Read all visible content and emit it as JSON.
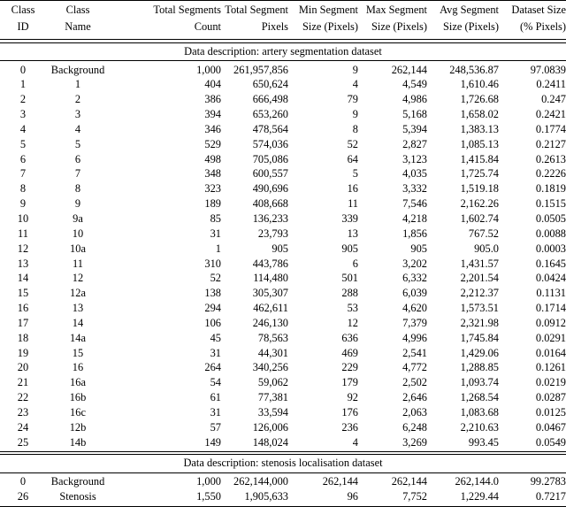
{
  "table": {
    "columns": [
      {
        "key": "class_id",
        "line1": "Class",
        "line2": "ID",
        "align": "center"
      },
      {
        "key": "class_name",
        "line1": "Class",
        "line2": "Name",
        "align": "center"
      },
      {
        "key": "total_count",
        "line1": "Total Segments",
        "line2": "Count",
        "align": "right"
      },
      {
        "key": "total_px",
        "line1": "Total Segment",
        "line2": "Pixels",
        "align": "right"
      },
      {
        "key": "min_px",
        "line1": "Min Segment",
        "line2": "Size (Pixels)",
        "align": "right"
      },
      {
        "key": "max_px",
        "line1": "Max Segment",
        "line2": "Size (Pixels)",
        "align": "right"
      },
      {
        "key": "avg_px",
        "line1": "Avg Segment",
        "line2": "Size (Pixels)",
        "align": "right"
      },
      {
        "key": "dataset_pct",
        "line1": "Dataset Size",
        "line2": "(% Pixels)",
        "align": "right"
      }
    ],
    "sections": [
      {
        "caption": "Data description: artery segmentation dataset",
        "rows": [
          {
            "class_id": "0",
            "class_name": "Background",
            "total_count": "1,000",
            "total_px": "261,957,856",
            "min_px": "9",
            "max_px": "262,144",
            "avg_px": "248,536.87",
            "dataset_pct": "97.0839"
          },
          {
            "class_id": "1",
            "class_name": "1",
            "total_count": "404",
            "total_px": "650,624",
            "min_px": "4",
            "max_px": "4,549",
            "avg_px": "1,610.46",
            "dataset_pct": "0.2411"
          },
          {
            "class_id": "2",
            "class_name": "2",
            "total_count": "386",
            "total_px": "666,498",
            "min_px": "79",
            "max_px": "4,986",
            "avg_px": "1,726.68",
            "dataset_pct": "0.247"
          },
          {
            "class_id": "3",
            "class_name": "3",
            "total_count": "394",
            "total_px": "653,260",
            "min_px": "9",
            "max_px": "5,168",
            "avg_px": "1,658.02",
            "dataset_pct": "0.2421"
          },
          {
            "class_id": "4",
            "class_name": "4",
            "total_count": "346",
            "total_px": "478,564",
            "min_px": "8",
            "max_px": "5,394",
            "avg_px": "1,383.13",
            "dataset_pct": "0.1774"
          },
          {
            "class_id": "5",
            "class_name": "5",
            "total_count": "529",
            "total_px": "574,036",
            "min_px": "52",
            "max_px": "2,827",
            "avg_px": "1,085.13",
            "dataset_pct": "0.2127"
          },
          {
            "class_id": "6",
            "class_name": "6",
            "total_count": "498",
            "total_px": "705,086",
            "min_px": "64",
            "max_px": "3,123",
            "avg_px": "1,415.84",
            "dataset_pct": "0.2613"
          },
          {
            "class_id": "7",
            "class_name": "7",
            "total_count": "348",
            "total_px": "600,557",
            "min_px": "5",
            "max_px": "4,035",
            "avg_px": "1,725.74",
            "dataset_pct": "0.2226"
          },
          {
            "class_id": "8",
            "class_name": "8",
            "total_count": "323",
            "total_px": "490,696",
            "min_px": "16",
            "max_px": "3,332",
            "avg_px": "1,519.18",
            "dataset_pct": "0.1819"
          },
          {
            "class_id": "9",
            "class_name": "9",
            "total_count": "189",
            "total_px": "408,668",
            "min_px": "11",
            "max_px": "7,546",
            "avg_px": "2,162.26",
            "dataset_pct": "0.1515"
          },
          {
            "class_id": "10",
            "class_name": "9a",
            "total_count": "85",
            "total_px": "136,233",
            "min_px": "339",
            "max_px": "4,218",
            "avg_px": "1,602.74",
            "dataset_pct": "0.0505"
          },
          {
            "class_id": "11",
            "class_name": "10",
            "total_count": "31",
            "total_px": "23,793",
            "min_px": "13",
            "max_px": "1,856",
            "avg_px": "767.52",
            "dataset_pct": "0.0088"
          },
          {
            "class_id": "12",
            "class_name": "10a",
            "total_count": "1",
            "total_px": "905",
            "min_px": "905",
            "max_px": "905",
            "avg_px": "905.0",
            "dataset_pct": "0.0003"
          },
          {
            "class_id": "13",
            "class_name": "11",
            "total_count": "310",
            "total_px": "443,786",
            "min_px": "6",
            "max_px": "3,202",
            "avg_px": "1,431.57",
            "dataset_pct": "0.1645"
          },
          {
            "class_id": "14",
            "class_name": "12",
            "total_count": "52",
            "total_px": "114,480",
            "min_px": "501",
            "max_px": "6,332",
            "avg_px": "2,201.54",
            "dataset_pct": "0.0424"
          },
          {
            "class_id": "15",
            "class_name": "12a",
            "total_count": "138",
            "total_px": "305,307",
            "min_px": "288",
            "max_px": "6,039",
            "avg_px": "2,212.37",
            "dataset_pct": "0.1131"
          },
          {
            "class_id": "16",
            "class_name": "13",
            "total_count": "294",
            "total_px": "462,611",
            "min_px": "53",
            "max_px": "4,620",
            "avg_px": "1,573.51",
            "dataset_pct": "0.1714"
          },
          {
            "class_id": "17",
            "class_name": "14",
            "total_count": "106",
            "total_px": "246,130",
            "min_px": "12",
            "max_px": "7,379",
            "avg_px": "2,321.98",
            "dataset_pct": "0.0912"
          },
          {
            "class_id": "18",
            "class_name": "14a",
            "total_count": "45",
            "total_px": "78,563",
            "min_px": "636",
            "max_px": "4,996",
            "avg_px": "1,745.84",
            "dataset_pct": "0.0291"
          },
          {
            "class_id": "19",
            "class_name": "15",
            "total_count": "31",
            "total_px": "44,301",
            "min_px": "469",
            "max_px": "2,541",
            "avg_px": "1,429.06",
            "dataset_pct": "0.0164"
          },
          {
            "class_id": "20",
            "class_name": "16",
            "total_count": "264",
            "total_px": "340,256",
            "min_px": "229",
            "max_px": "4,772",
            "avg_px": "1,288.85",
            "dataset_pct": "0.1261"
          },
          {
            "class_id": "21",
            "class_name": "16a",
            "total_count": "54",
            "total_px": "59,062",
            "min_px": "179",
            "max_px": "2,502",
            "avg_px": "1,093.74",
            "dataset_pct": "0.0219"
          },
          {
            "class_id": "22",
            "class_name": "16b",
            "total_count": "61",
            "total_px": "77,381",
            "min_px": "92",
            "max_px": "2,646",
            "avg_px": "1,268.54",
            "dataset_pct": "0.0287"
          },
          {
            "class_id": "23",
            "class_name": "16c",
            "total_count": "31",
            "total_px": "33,594",
            "min_px": "176",
            "max_px": "2,063",
            "avg_px": "1,083.68",
            "dataset_pct": "0.0125"
          },
          {
            "class_id": "24",
            "class_name": "12b",
            "total_count": "57",
            "total_px": "126,006",
            "min_px": "236",
            "max_px": "6,248",
            "avg_px": "2,210.63",
            "dataset_pct": "0.0467"
          },
          {
            "class_id": "25",
            "class_name": "14b",
            "total_count": "149",
            "total_px": "148,024",
            "min_px": "4",
            "max_px": "3,269",
            "avg_px": "993.45",
            "dataset_pct": "0.0549"
          }
        ]
      },
      {
        "caption": "Data description: stenosis localisation dataset",
        "rows": [
          {
            "class_id": "0",
            "class_name": "Background",
            "total_count": "1,000",
            "total_px": "262,144,000",
            "min_px": "262,144",
            "max_px": "262,144",
            "avg_px": "262,144.0",
            "dataset_pct": "99.2783"
          },
          {
            "class_id": "26",
            "class_name": "Stenosis",
            "total_count": "1,550",
            "total_px": "1,905,633",
            "min_px": "96",
            "max_px": "7,752",
            "avg_px": "1,229.44",
            "dataset_pct": "0.7217"
          }
        ]
      }
    ]
  }
}
